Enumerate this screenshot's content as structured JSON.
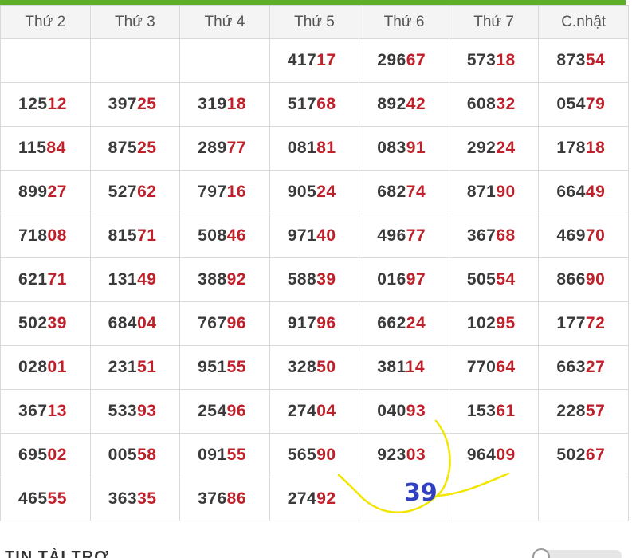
{
  "colors": {
    "accent_bar": "#5fae2a",
    "number_lead": "#3a3a3a",
    "number_tail": "#c0202a",
    "annotation_stroke": "#f2e600",
    "annotation_text": "#3040c0"
  },
  "table": {
    "headers": [
      "Thứ 2",
      "Thứ 3",
      "Thứ 4",
      "Thứ 5",
      "Thứ 6",
      "Thứ 7",
      "C.nhật"
    ],
    "rows": [
      [
        {
          "lead": "",
          "tail": ""
        },
        {
          "lead": "",
          "tail": ""
        },
        {
          "lead": "",
          "tail": ""
        },
        {
          "lead": "417",
          "tail": "17"
        },
        {
          "lead": "296",
          "tail": "67"
        },
        {
          "lead": "573",
          "tail": "18"
        },
        {
          "lead": "873",
          "tail": "54"
        }
      ],
      [
        {
          "lead": "125",
          "tail": "12"
        },
        {
          "lead": "397",
          "tail": "25"
        },
        {
          "lead": "319",
          "tail": "18"
        },
        {
          "lead": "517",
          "tail": "68"
        },
        {
          "lead": "892",
          "tail": "42"
        },
        {
          "lead": "608",
          "tail": "32"
        },
        {
          "lead": "054",
          "tail": "79"
        }
      ],
      [
        {
          "lead": "115",
          "tail": "84"
        },
        {
          "lead": "875",
          "tail": "25"
        },
        {
          "lead": "289",
          "tail": "77"
        },
        {
          "lead": "081",
          "tail": "81"
        },
        {
          "lead": "083",
          "tail": "91"
        },
        {
          "lead": "292",
          "tail": "24"
        },
        {
          "lead": "178",
          "tail": "18"
        }
      ],
      [
        {
          "lead": "899",
          "tail": "27"
        },
        {
          "lead": "527",
          "tail": "62"
        },
        {
          "lead": "797",
          "tail": "16"
        },
        {
          "lead": "905",
          "tail": "24"
        },
        {
          "lead": "682",
          "tail": "74"
        },
        {
          "lead": "871",
          "tail": "90"
        },
        {
          "lead": "664",
          "tail": "49"
        }
      ],
      [
        {
          "lead": "718",
          "tail": "08"
        },
        {
          "lead": "815",
          "tail": "71"
        },
        {
          "lead": "508",
          "tail": "46"
        },
        {
          "lead": "971",
          "tail": "40"
        },
        {
          "lead": "496",
          "tail": "77"
        },
        {
          "lead": "367",
          "tail": "68"
        },
        {
          "lead": "469",
          "tail": "70"
        }
      ],
      [
        {
          "lead": "621",
          "tail": "71"
        },
        {
          "lead": "131",
          "tail": "49"
        },
        {
          "lead": "388",
          "tail": "92"
        },
        {
          "lead": "588",
          "tail": "39"
        },
        {
          "lead": "016",
          "tail": "97"
        },
        {
          "lead": "505",
          "tail": "54"
        },
        {
          "lead": "866",
          "tail": "90"
        }
      ],
      [
        {
          "lead": "502",
          "tail": "39"
        },
        {
          "lead": "684",
          "tail": "04"
        },
        {
          "lead": "767",
          "tail": "96"
        },
        {
          "lead": "917",
          "tail": "96"
        },
        {
          "lead": "662",
          "tail": "24"
        },
        {
          "lead": "102",
          "tail": "95"
        },
        {
          "lead": "177",
          "tail": "72"
        }
      ],
      [
        {
          "lead": "028",
          "tail": "01"
        },
        {
          "lead": "231",
          "tail": "51"
        },
        {
          "lead": "951",
          "tail": "55"
        },
        {
          "lead": "328",
          "tail": "50"
        },
        {
          "lead": "381",
          "tail": "14"
        },
        {
          "lead": "770",
          "tail": "64"
        },
        {
          "lead": "663",
          "tail": "27"
        }
      ],
      [
        {
          "lead": "367",
          "tail": "13"
        },
        {
          "lead": "533",
          "tail": "93"
        },
        {
          "lead": "254",
          "tail": "96"
        },
        {
          "lead": "274",
          "tail": "04"
        },
        {
          "lead": "040",
          "tail": "93"
        },
        {
          "lead": "153",
          "tail": "61"
        },
        {
          "lead": "228",
          "tail": "57"
        }
      ],
      [
        {
          "lead": "695",
          "tail": "02"
        },
        {
          "lead": "005",
          "tail": "58"
        },
        {
          "lead": "091",
          "tail": "55"
        },
        {
          "lead": "565",
          "tail": "90"
        },
        {
          "lead": "923",
          "tail": "03"
        },
        {
          "lead": "964",
          "tail": "09"
        },
        {
          "lead": "502",
          "tail": "67"
        }
      ],
      [
        {
          "lead": "465",
          "tail": "55"
        },
        {
          "lead": "363",
          "tail": "35"
        },
        {
          "lead": "376",
          "tail": "86"
        },
        {
          "lead": "274",
          "tail": "92"
        },
        {
          "lead": "",
          "tail": ""
        },
        {
          "lead": "",
          "tail": ""
        },
        {
          "lead": "",
          "tail": ""
        }
      ]
    ]
  },
  "annotation": {
    "label": "39"
  },
  "footer": {
    "section_title": "TIN TÀI TRỢ"
  }
}
